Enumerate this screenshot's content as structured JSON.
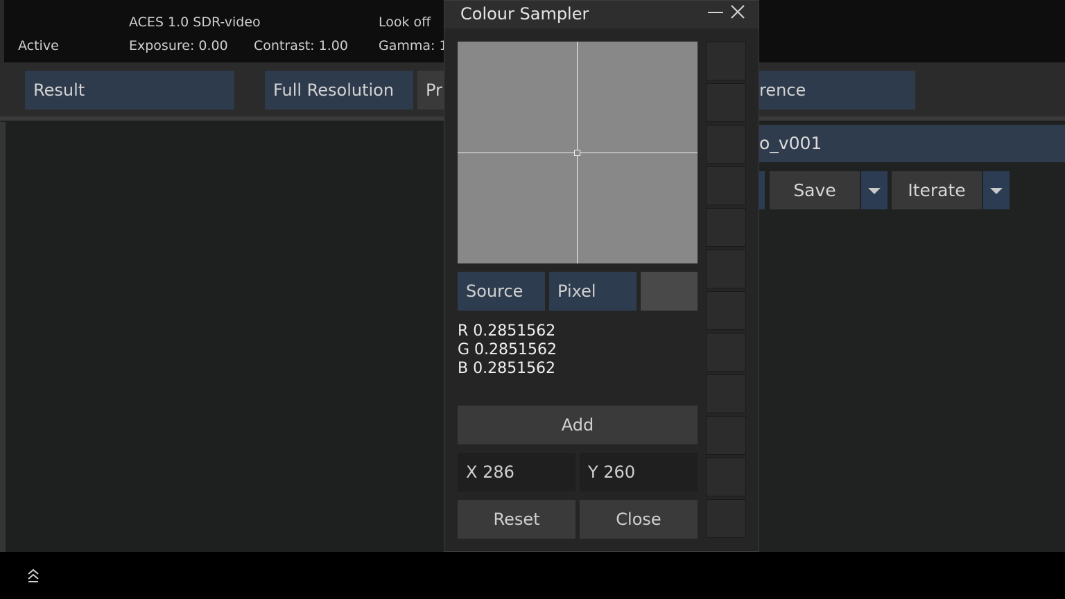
{
  "top_status": {
    "state": "Active",
    "display": "ACES 1.0 SDR-video",
    "exposure": "Exposure: 0.00",
    "contrast": "Contrast: 1.00",
    "look": "Look off",
    "gamma": "Gamma: 1"
  },
  "tabs": {
    "result": "Result",
    "resolution": "Full Resolution",
    "partial": "Pr",
    "reference_partial": "rence"
  },
  "right_panel": {
    "filename_partial": "o_v001",
    "save_label": "Save",
    "iterate_label": "Iterate"
  },
  "dialog": {
    "title": "Colour Sampler",
    "source_label": "Source",
    "pixel_label": "Pixel",
    "swatch_color": "#494949",
    "r_line": "R 0.2851562",
    "g_line": "G 0.2851562",
    "b_line": "B 0.2851562",
    "add_label": "Add",
    "x_field": "X 286",
    "y_field": "Y 260",
    "reset_label": "Reset",
    "close_label": "Close"
  },
  "colors": {
    "accent_blue": "#2e3c4f",
    "preview_grey": "#888888"
  }
}
